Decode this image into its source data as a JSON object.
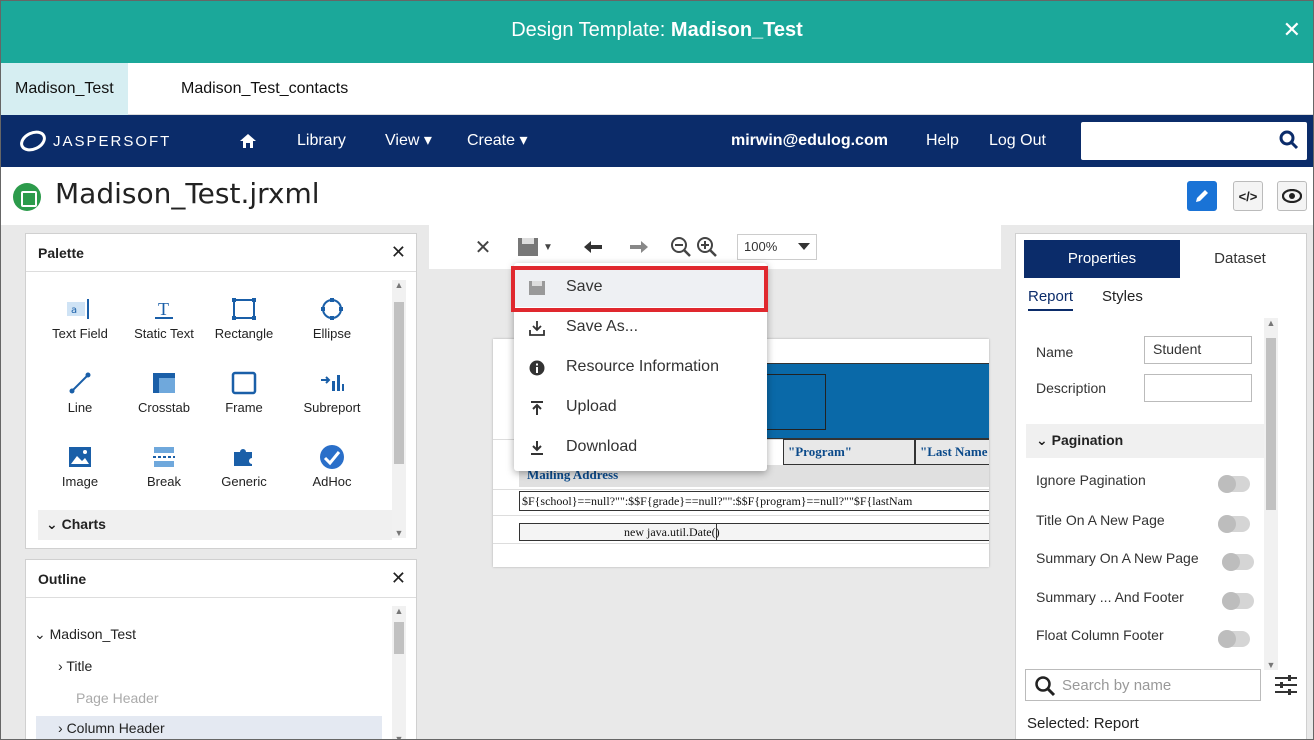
{
  "dialog": {
    "title_prefix": "Design Template: ",
    "title_name": "Madison_Test",
    "close": "✕"
  },
  "tabs": [
    {
      "label": "Madison_Test",
      "active": true
    },
    {
      "label": "Madison_Test_contacts",
      "active": false
    }
  ],
  "navbar": {
    "logo_text": "JASPERSOFT",
    "home_icon": "home-icon",
    "library": "Library",
    "view": "View",
    "create": "Create",
    "user": "mirwin@edulog.com",
    "help": "Help",
    "logout": "Log Out",
    "search_value": ""
  },
  "file": {
    "name": "Madison_Test.jrxml"
  },
  "palette": {
    "title": "Palette",
    "close": "✕",
    "items": [
      "Text Field",
      "Static Text",
      "Rectangle",
      "Ellipse",
      "Line",
      "Crosstab",
      "Frame",
      "Subreport",
      "Image",
      "Break",
      "Generic",
      "AdHoc"
    ],
    "charts": "Charts"
  },
  "outline": {
    "title": "Outline",
    "close": "✕",
    "items": [
      "Madison_Test",
      "Title",
      "Page Header",
      "Column Header"
    ]
  },
  "toolbar": {
    "zoom": "100%"
  },
  "report": {
    "headers": [
      "\"Program\"",
      "\"Last Name"
    ],
    "mailing": "Mailing Address",
    "detail": "$F{school}==null?\"\":$$F{grade}==null?\"\":$$F{program}==null?\"\"$F{lastNam",
    "footer": "new java.util.Date()"
  },
  "save_menu": {
    "items": [
      "Save",
      "Save As...",
      "Resource Information",
      "Upload",
      "Download"
    ]
  },
  "properties": {
    "tab_properties": "Properties",
    "tab_dataset": "Dataset",
    "sub_report": "Report",
    "sub_styles": "Styles",
    "name_label": "Name",
    "name_value": "Student",
    "description_label": "Description",
    "description_value": "",
    "pagination": "Pagination",
    "toggles": [
      "Ignore Pagination",
      "Title On A New Page",
      "Summary On A New Page",
      "Summary ...  And Footer",
      "Float Column Footer"
    ],
    "search_placeholder": "Search by name",
    "selected": "Selected: Report"
  }
}
